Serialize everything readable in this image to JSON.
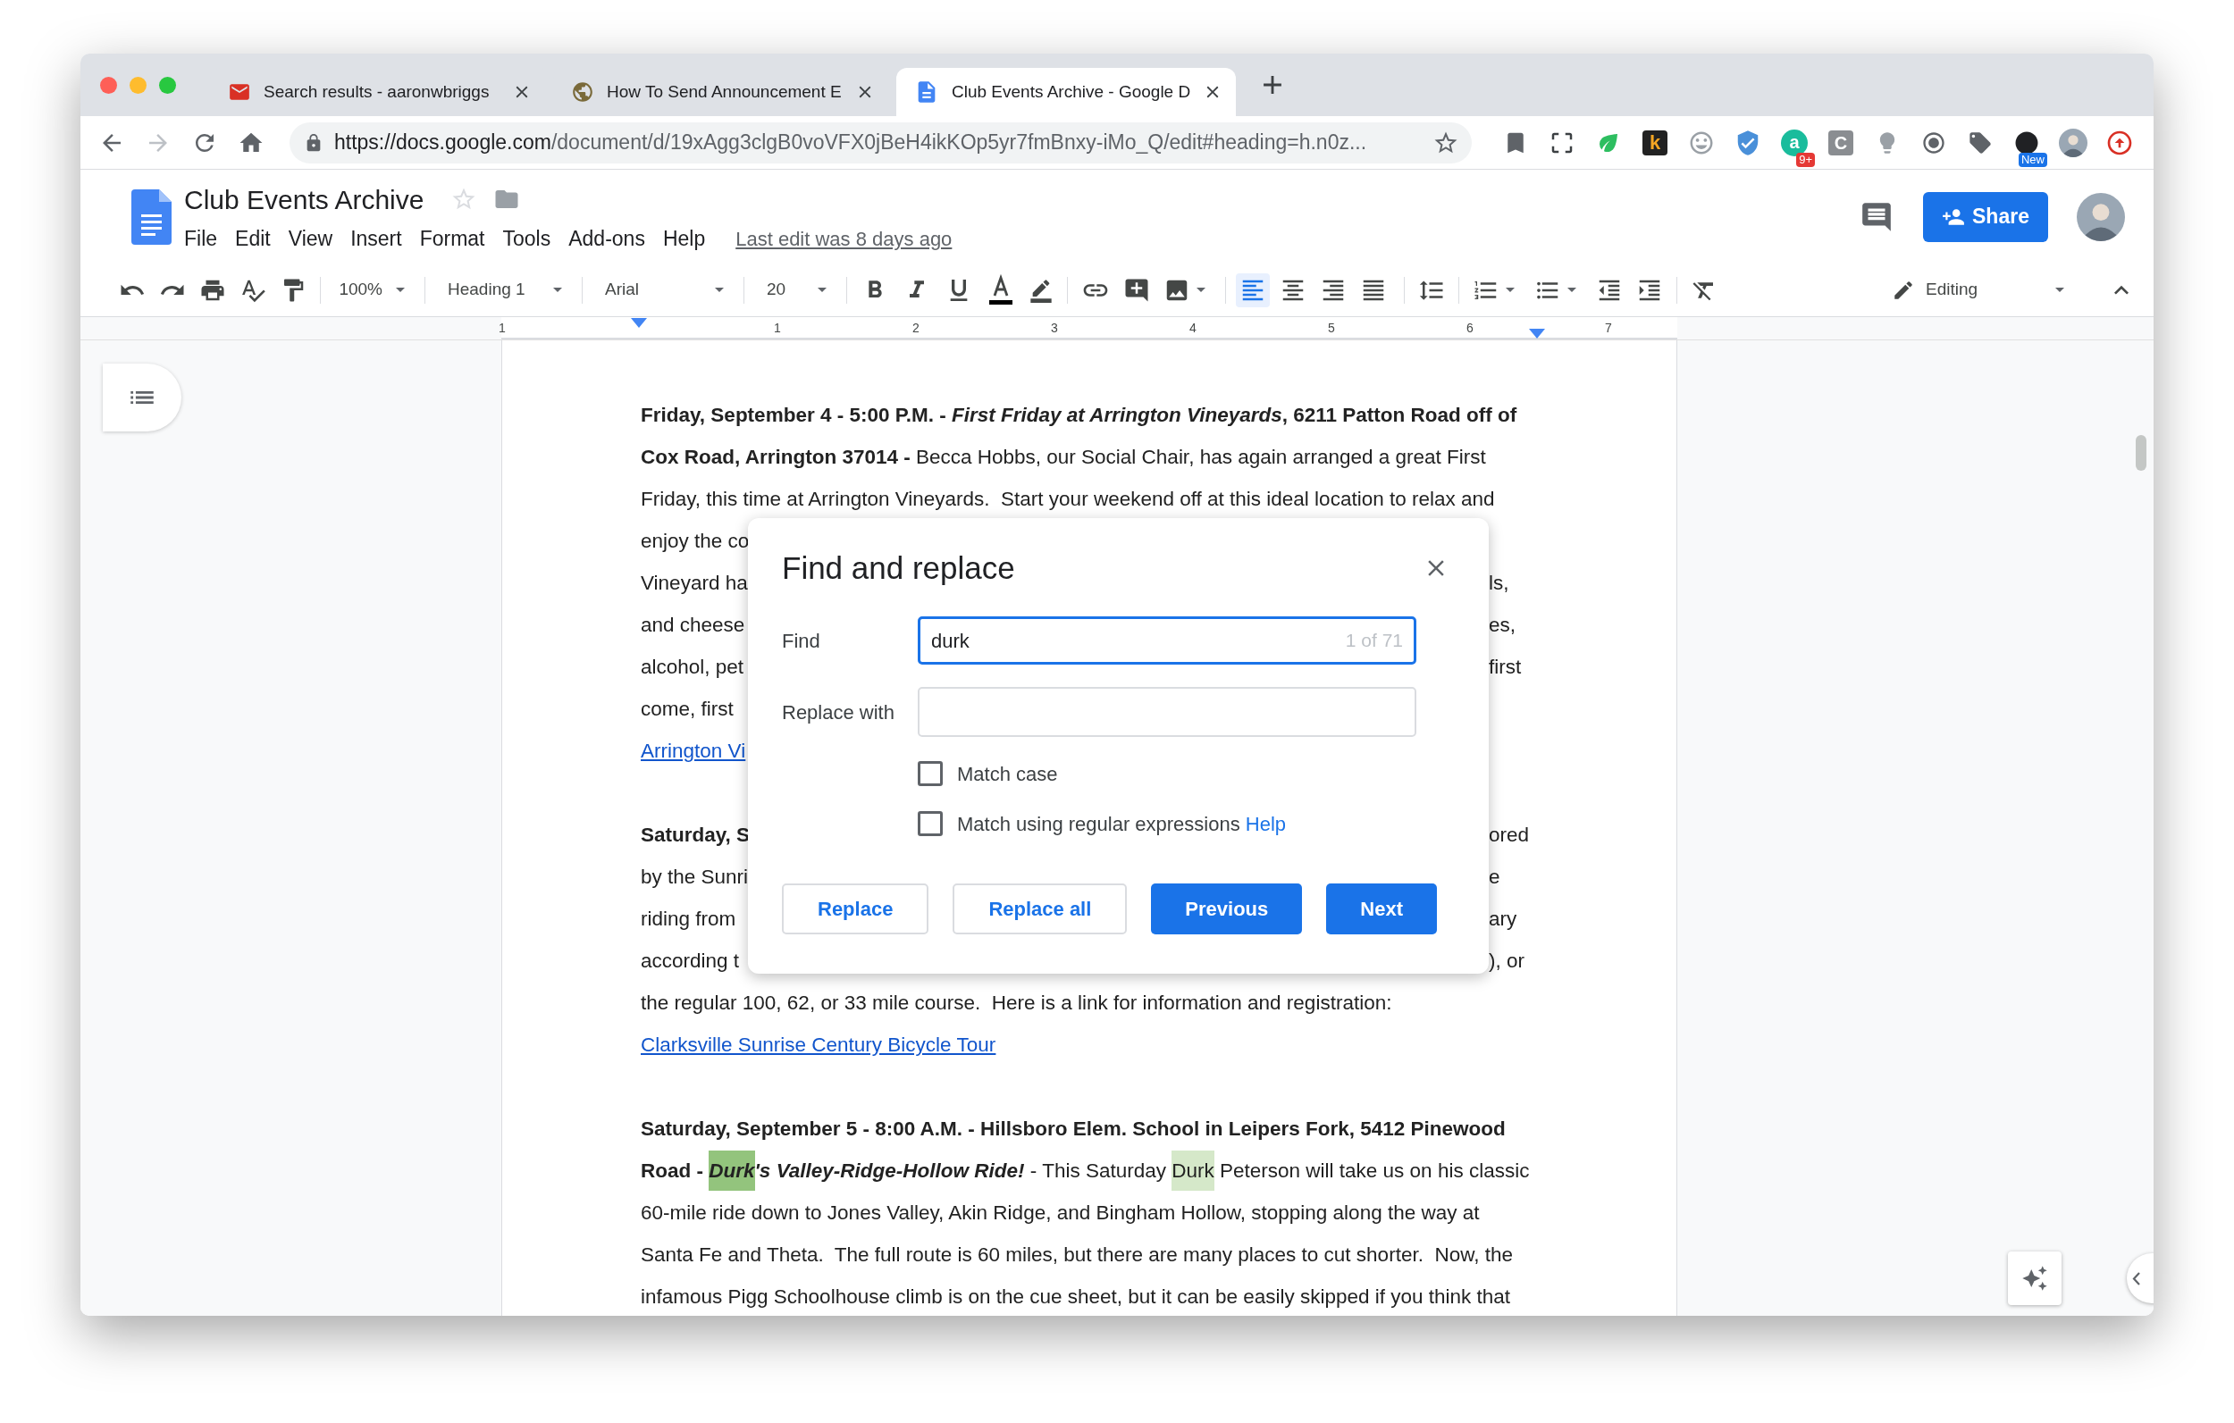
{
  "browser": {
    "tabs": [
      {
        "title": "Search results - aaronwbriggs",
        "kind": "mail",
        "selected": false
      },
      {
        "title": "How To Send Announcement E",
        "kind": "globe",
        "selected": false
      },
      {
        "title": "Club Events Archive - Google D",
        "kind": "docs",
        "selected": true
      }
    ],
    "url": {
      "host": "https://docs.google.com",
      "path": "/document/d/19xAgg3clgB0voVFX0jBeH4ikKOp5yr7fmBnxy-iMo_Q/edit#heading=h.n0z..."
    },
    "extensions": [
      {
        "kind": "pocket"
      },
      {
        "kind": "screenshot"
      },
      {
        "kind": "leaf"
      },
      {
        "kind": "letter_dark",
        "label": "k"
      },
      {
        "kind": "face"
      },
      {
        "kind": "shield"
      },
      {
        "kind": "letter_round",
        "label": "a",
        "badge": "9+"
      },
      {
        "kind": "letter_gray",
        "label": "C"
      },
      {
        "kind": "bulb"
      },
      {
        "kind": "ring"
      },
      {
        "kind": "tag"
      },
      {
        "kind": "dark_circle",
        "badge": "New"
      },
      {
        "kind": "avatar"
      },
      {
        "kind": "upload"
      }
    ]
  },
  "docs": {
    "title": "Club Events Archive",
    "menus": [
      "File",
      "Edit",
      "View",
      "Insert",
      "Format",
      "Tools",
      "Add-ons",
      "Help"
    ],
    "last_edit": "Last edit was 8 days ago",
    "share": "Share"
  },
  "toolbar": {
    "zoom": "100%",
    "style": "Heading 1",
    "font": "Arial",
    "size": "20",
    "alignment": [
      {
        "kind": "left",
        "selected": true
      },
      {
        "kind": "center",
        "selected": false
      },
      {
        "kind": "right",
        "selected": false
      },
      {
        "kind": "justify",
        "selected": false
      }
    ],
    "mode": "Editing"
  },
  "ruler": {
    "labels": [
      "1",
      "1",
      "2",
      "3",
      "4",
      "5",
      "6",
      "7"
    ]
  },
  "document": {
    "lines": [
      {
        "kind": "text",
        "runs": [
          {
            "text": "Friday, September 4 - 5:00 P.M. - ",
            "kind": "bold"
          },
          {
            "text": "First Friday at Arrington Vineyards",
            "kind": "bold_italic"
          },
          {
            "text": ", 6211 Patton Road off of",
            "kind": "bold"
          }
        ]
      },
      {
        "kind": "text",
        "runs": [
          {
            "text": "Cox Road, Arrington 37014 - ",
            "kind": "bold"
          },
          {
            "text": "Becca Hobbs, our Social Chair, has again arranged a great First",
            "kind": "plain"
          }
        ]
      },
      {
        "kind": "text",
        "runs": [
          {
            "text": "Friday, this time at Arrington Vineyards.  Start your weekend off at this ideal location to relax and",
            "kind": "plain"
          }
        ]
      },
      {
        "kind": "text",
        "runs": [
          {
            "text": "enjoy the co",
            "kind": "plain"
          }
        ]
      },
      {
        "kind": "text",
        "runs": [
          {
            "text": "Vineyard ha",
            "kind": "plain"
          }
        ],
        "right": "ls,"
      },
      {
        "kind": "text",
        "runs": [
          {
            "text": "and cheese",
            "kind": "plain"
          }
        ],
        "right": "es,"
      },
      {
        "kind": "text",
        "runs": [
          {
            "text": "alcohol, pet",
            "kind": "plain"
          }
        ],
        "right": "first"
      },
      {
        "kind": "text",
        "runs": [
          {
            "text": "come, first",
            "kind": "plain"
          }
        ]
      },
      {
        "kind": "link",
        "runs": [
          {
            "text": "Arrington Vi",
            "kind": "link"
          }
        ]
      },
      {
        "kind": "blank"
      },
      {
        "kind": "text",
        "runs": [
          {
            "text": "Saturday, S",
            "kind": "bold"
          }
        ],
        "right": "ored"
      },
      {
        "kind": "text",
        "runs": [
          {
            "text": "by the Sunri",
            "kind": "plain"
          }
        ],
        "right": "e"
      },
      {
        "kind": "text",
        "runs": [
          {
            "text": "riding from",
            "kind": "plain"
          }
        ],
        "right": "ary"
      },
      {
        "kind": "text",
        "runs": [
          {
            "text": "according t",
            "kind": "plain"
          }
        ],
        "right": "), or"
      },
      {
        "kind": "text",
        "runs": [
          {
            "text": "the regular 100, 62, or 33 mile course.  Here is a link for information and registration:",
            "kind": "plain"
          }
        ]
      },
      {
        "kind": "link",
        "runs": [
          {
            "text": "Clarksville Sunrise Century Bicycle Tour",
            "kind": "link"
          }
        ]
      },
      {
        "kind": "blank"
      },
      {
        "kind": "text",
        "runs": [
          {
            "text": "Saturday, September 5 - 8:00 A.M. - Hillsboro Elem. School in Leipers Fork, 5412 Pinewood",
            "kind": "bold"
          }
        ]
      },
      {
        "kind": "text",
        "runs": [
          {
            "text": "Road - ",
            "kind": "bold"
          },
          {
            "text": "Durk",
            "kind": "bold_italic",
            "highlighted": true,
            "current": true
          },
          {
            "text": "'s Valley-Ridge-Hollow Ride!",
            "kind": "bold_italic"
          },
          {
            "text": " - This Saturday ",
            "kind": "plain"
          },
          {
            "text": "Durk",
            "kind": "plain",
            "highlighted": true,
            "current": false
          },
          {
            "text": " Peterson will take us on his classic",
            "kind": "plain"
          }
        ]
      },
      {
        "kind": "text",
        "runs": [
          {
            "text": "60-mile ride down to Jones Valley, Akin Ridge, and Bingham Hollow, stopping along the way at",
            "kind": "plain"
          }
        ]
      },
      {
        "kind": "text",
        "runs": [
          {
            "text": "Santa Fe and Theta.  The full route is 60 miles, but there are many places to cut shorter.  Now, the",
            "kind": "plain"
          }
        ]
      },
      {
        "kind": "text",
        "runs": [
          {
            "text": "infamous Pigg Schoolhouse climb is on the cue sheet, but it can be easily skipped if you think that",
            "kind": "plain"
          }
        ]
      }
    ]
  },
  "dialog": {
    "title": "Find and replace",
    "find_label": "Find",
    "find_value": "durk",
    "count": "1 of 71",
    "replace_label": "Replace with",
    "options": [
      {
        "label": "Match case",
        "checked": false
      },
      {
        "label": "Match using regular expressions",
        "checked": false,
        "link": "Help"
      }
    ],
    "buttons": [
      {
        "label": "Replace",
        "kind": "outline"
      },
      {
        "label": "Replace all",
        "kind": "outline"
      },
      {
        "label": "Previous",
        "kind": "primary"
      },
      {
        "label": "Next",
        "kind": "primary"
      }
    ]
  }
}
